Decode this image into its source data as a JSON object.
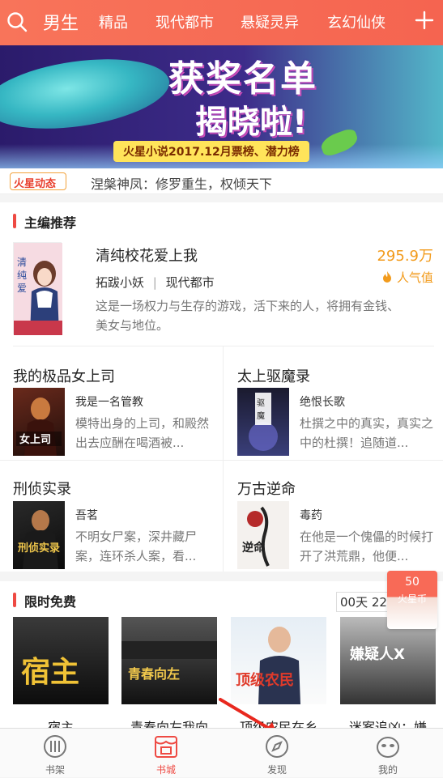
{
  "top_nav": {
    "categories": [
      {
        "label": "男生",
        "active": true
      },
      {
        "label": "精品"
      },
      {
        "label": "现代都市"
      },
      {
        "label": "悬疑灵异"
      },
      {
        "label": "玄幻仙侠"
      }
    ],
    "search_icon": "search-icon",
    "add_icon": "plus-icon"
  },
  "banner": {
    "headline_1": "获奖名单",
    "headline_2": "揭晓啦!",
    "subline": "火星小说2017.12月票榜、潜力榜"
  },
  "news": {
    "logo": "火星动态",
    "text": "涅槃神凤：修罗重生，权倾天下"
  },
  "editor_pick": {
    "section_title": "主编推荐",
    "hero": {
      "title": "清纯校花爱上我",
      "author": "拓跋小妖",
      "genre": "现代都市",
      "separator": "|",
      "description": "这是一场权力与生存的游戏，活下来的人，将拥有金钱、美女与地位。",
      "heat_value": "295.9万",
      "heat_label": "人气值"
    },
    "grid": [
      {
        "title": "我的极品女上司",
        "author": "我是一名管教",
        "description": "模特出身的上司，和殿然出去应酬在喝酒被..."
      },
      {
        "title": "太上驱魔录",
        "author": "绝恨长歌",
        "description": "杜撰之中的真实，真实之中的杜撰！追随道..."
      },
      {
        "title": "刑侦实录",
        "author": "吾茗",
        "description": "不明女尸案，深井藏尸案，连环杀人案，看..."
      },
      {
        "title": "万古逆命",
        "author": "毒药",
        "description": "在他是一个傀儡的时候打开了洪荒鼎，他便..."
      }
    ]
  },
  "free": {
    "section_title": "限时免费",
    "countdown": "00天 22",
    "books": [
      {
        "title": "宿主"
      },
      {
        "title": "青春向左我向"
      },
      {
        "title": "顶级农民在乡"
      },
      {
        "title": "迷案追凶：嫌"
      }
    ]
  },
  "envelope": {
    "value": "50",
    "unit": "火星币"
  },
  "tabbar": [
    {
      "label": "书架",
      "icon": "bookshelf-icon"
    },
    {
      "label": "书城",
      "icon": "store-icon",
      "active": true
    },
    {
      "label": "发现",
      "icon": "compass-icon"
    },
    {
      "label": "我的",
      "icon": "profile-icon"
    }
  ],
  "colors": {
    "accent": "#ee4a43",
    "topbar": "#f56b54",
    "heat": "#f29b1c"
  }
}
